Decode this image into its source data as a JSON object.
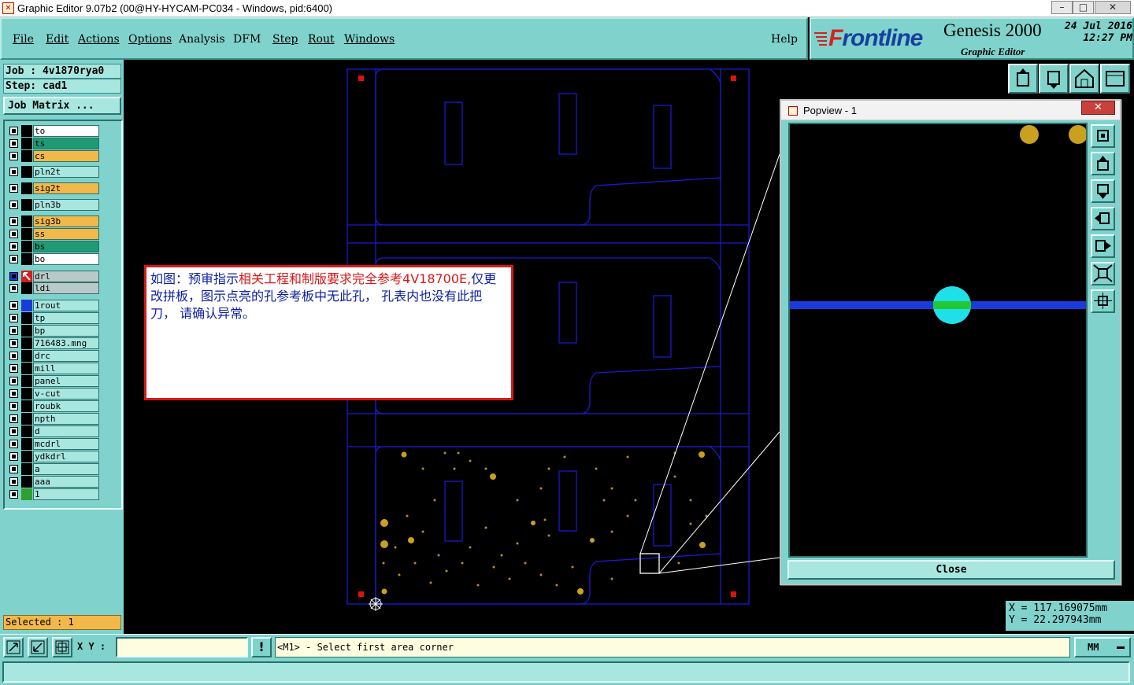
{
  "window": {
    "title": "Graphic Editor 9.07b2 (00@HY-HYCAM-PC034 - Windows, pid:6400)",
    "controls": [
      "–",
      "□",
      "✕"
    ]
  },
  "menu": {
    "items": [
      "File",
      "Edit",
      "Actions",
      "Options",
      "Analysis",
      "DFM",
      "Step",
      "Rout",
      "Windows"
    ],
    "help": "Help"
  },
  "brand": {
    "logo_first": "F",
    "logo_rest": "rontline",
    "product": "Genesis 2000",
    "subtitle": "Graphic Editor",
    "date": "24 Jul 2016",
    "time": "12:27 PM"
  },
  "job": {
    "job_label": "Job : 4v1870rya0",
    "step_label": "Step: cad1",
    "matrix_button": "Job Matrix ..."
  },
  "layers": [
    {
      "name": "to",
      "color": "#ffffff",
      "swatch": "#000000"
    },
    {
      "name": "ts",
      "color": "#1f9a74",
      "swatch": "#000000"
    },
    {
      "name": "cs",
      "color": "#f2b84a",
      "swatch": "#000000"
    },
    {
      "name": "pln2t",
      "color": "#a8e6e0",
      "swatch": "#000000"
    },
    {
      "name": "sig2t",
      "color": "#f2b84a",
      "swatch": "#000000"
    },
    {
      "name": "pln3b",
      "color": "#a8e6e0",
      "swatch": "#000000"
    },
    {
      "name": "sig3b",
      "color": "#f2b84a",
      "swatch": "#000000"
    },
    {
      "name": "ss",
      "color": "#f2b84a",
      "swatch": "#000000"
    },
    {
      "name": "bs",
      "color": "#1f9a74",
      "swatch": "#000000"
    },
    {
      "name": "bo",
      "color": "#ffffff",
      "swatch": "#000000"
    },
    {
      "name": "drl",
      "color": "#b9c9c7",
      "swatch": "#ffffff"
    },
    {
      "name": "ldi",
      "color": "#b9c9c7",
      "swatch": "#000000"
    },
    {
      "name": "1rout",
      "color": "#a8e6e0",
      "swatch": "#1a3bdc"
    },
    {
      "name": "tp",
      "color": "#a8e6e0",
      "swatch": "#000000"
    },
    {
      "name": "bp",
      "color": "#a8e6e0",
      "swatch": "#000000"
    },
    {
      "name": "716483.mng",
      "color": "#a8e6e0",
      "swatch": "#000000"
    },
    {
      "name": "drc",
      "color": "#a8e6e0",
      "swatch": "#000000"
    },
    {
      "name": "mill",
      "color": "#a8e6e0",
      "swatch": "#000000"
    },
    {
      "name": "panel",
      "color": "#a8e6e0",
      "swatch": "#000000"
    },
    {
      "name": "v-cut",
      "color": "#a8e6e0",
      "swatch": "#000000"
    },
    {
      "name": "roubk",
      "color": "#a8e6e0",
      "swatch": "#000000"
    },
    {
      "name": "npth",
      "color": "#a8e6e0",
      "swatch": "#000000"
    },
    {
      "name": "d",
      "color": "#a8e6e0",
      "swatch": "#000000"
    },
    {
      "name": "mcdrl",
      "color": "#a8e6e0",
      "swatch": "#000000"
    },
    {
      "name": "ydkdrl",
      "color": "#a8e6e0",
      "swatch": "#000000"
    },
    {
      "name": "a",
      "color": "#a8e6e0",
      "swatch": "#000000"
    },
    {
      "name": "aaa",
      "color": "#a8e6e0",
      "swatch": "#000000"
    },
    {
      "name": "1",
      "color": "#a8e6e0",
      "swatch": "#2fa02f"
    }
  ],
  "selected": "Selected : 1",
  "annotation": {
    "part1_blue": "如图：预审指示",
    "part2_red": "相关工程和制版要求完全参考4V18700E,",
    "part3_blue": "仅更改拼板，图示点亮的孔参考板中无此孔， 孔表内也没有此把刀， 请确认异常。"
  },
  "popview": {
    "title": "Popview - 1",
    "close_label": "Close",
    "close_x": "✕"
  },
  "coords": {
    "x": "X = 117.169075mm",
    "y": "Y = 22.297943mm"
  },
  "bottom": {
    "xy_label": "X Y :",
    "xy_value": "",
    "warn": "!",
    "prompt": "<M1> - Select first area corner",
    "units": "MM"
  },
  "icons": {
    "toolbar_right": [
      "open-icon",
      "save-icon",
      "home-icon",
      "window-icon"
    ],
    "popview_tools": [
      "zoom-home-icon",
      "pan-up-icon",
      "pan-down-icon",
      "pan-left-icon",
      "pan-right-icon",
      "fit-icon",
      "zoom-area-icon"
    ],
    "bottom_tools": [
      "zoom-area-icon",
      "measure-icon",
      "snap-icon"
    ]
  }
}
